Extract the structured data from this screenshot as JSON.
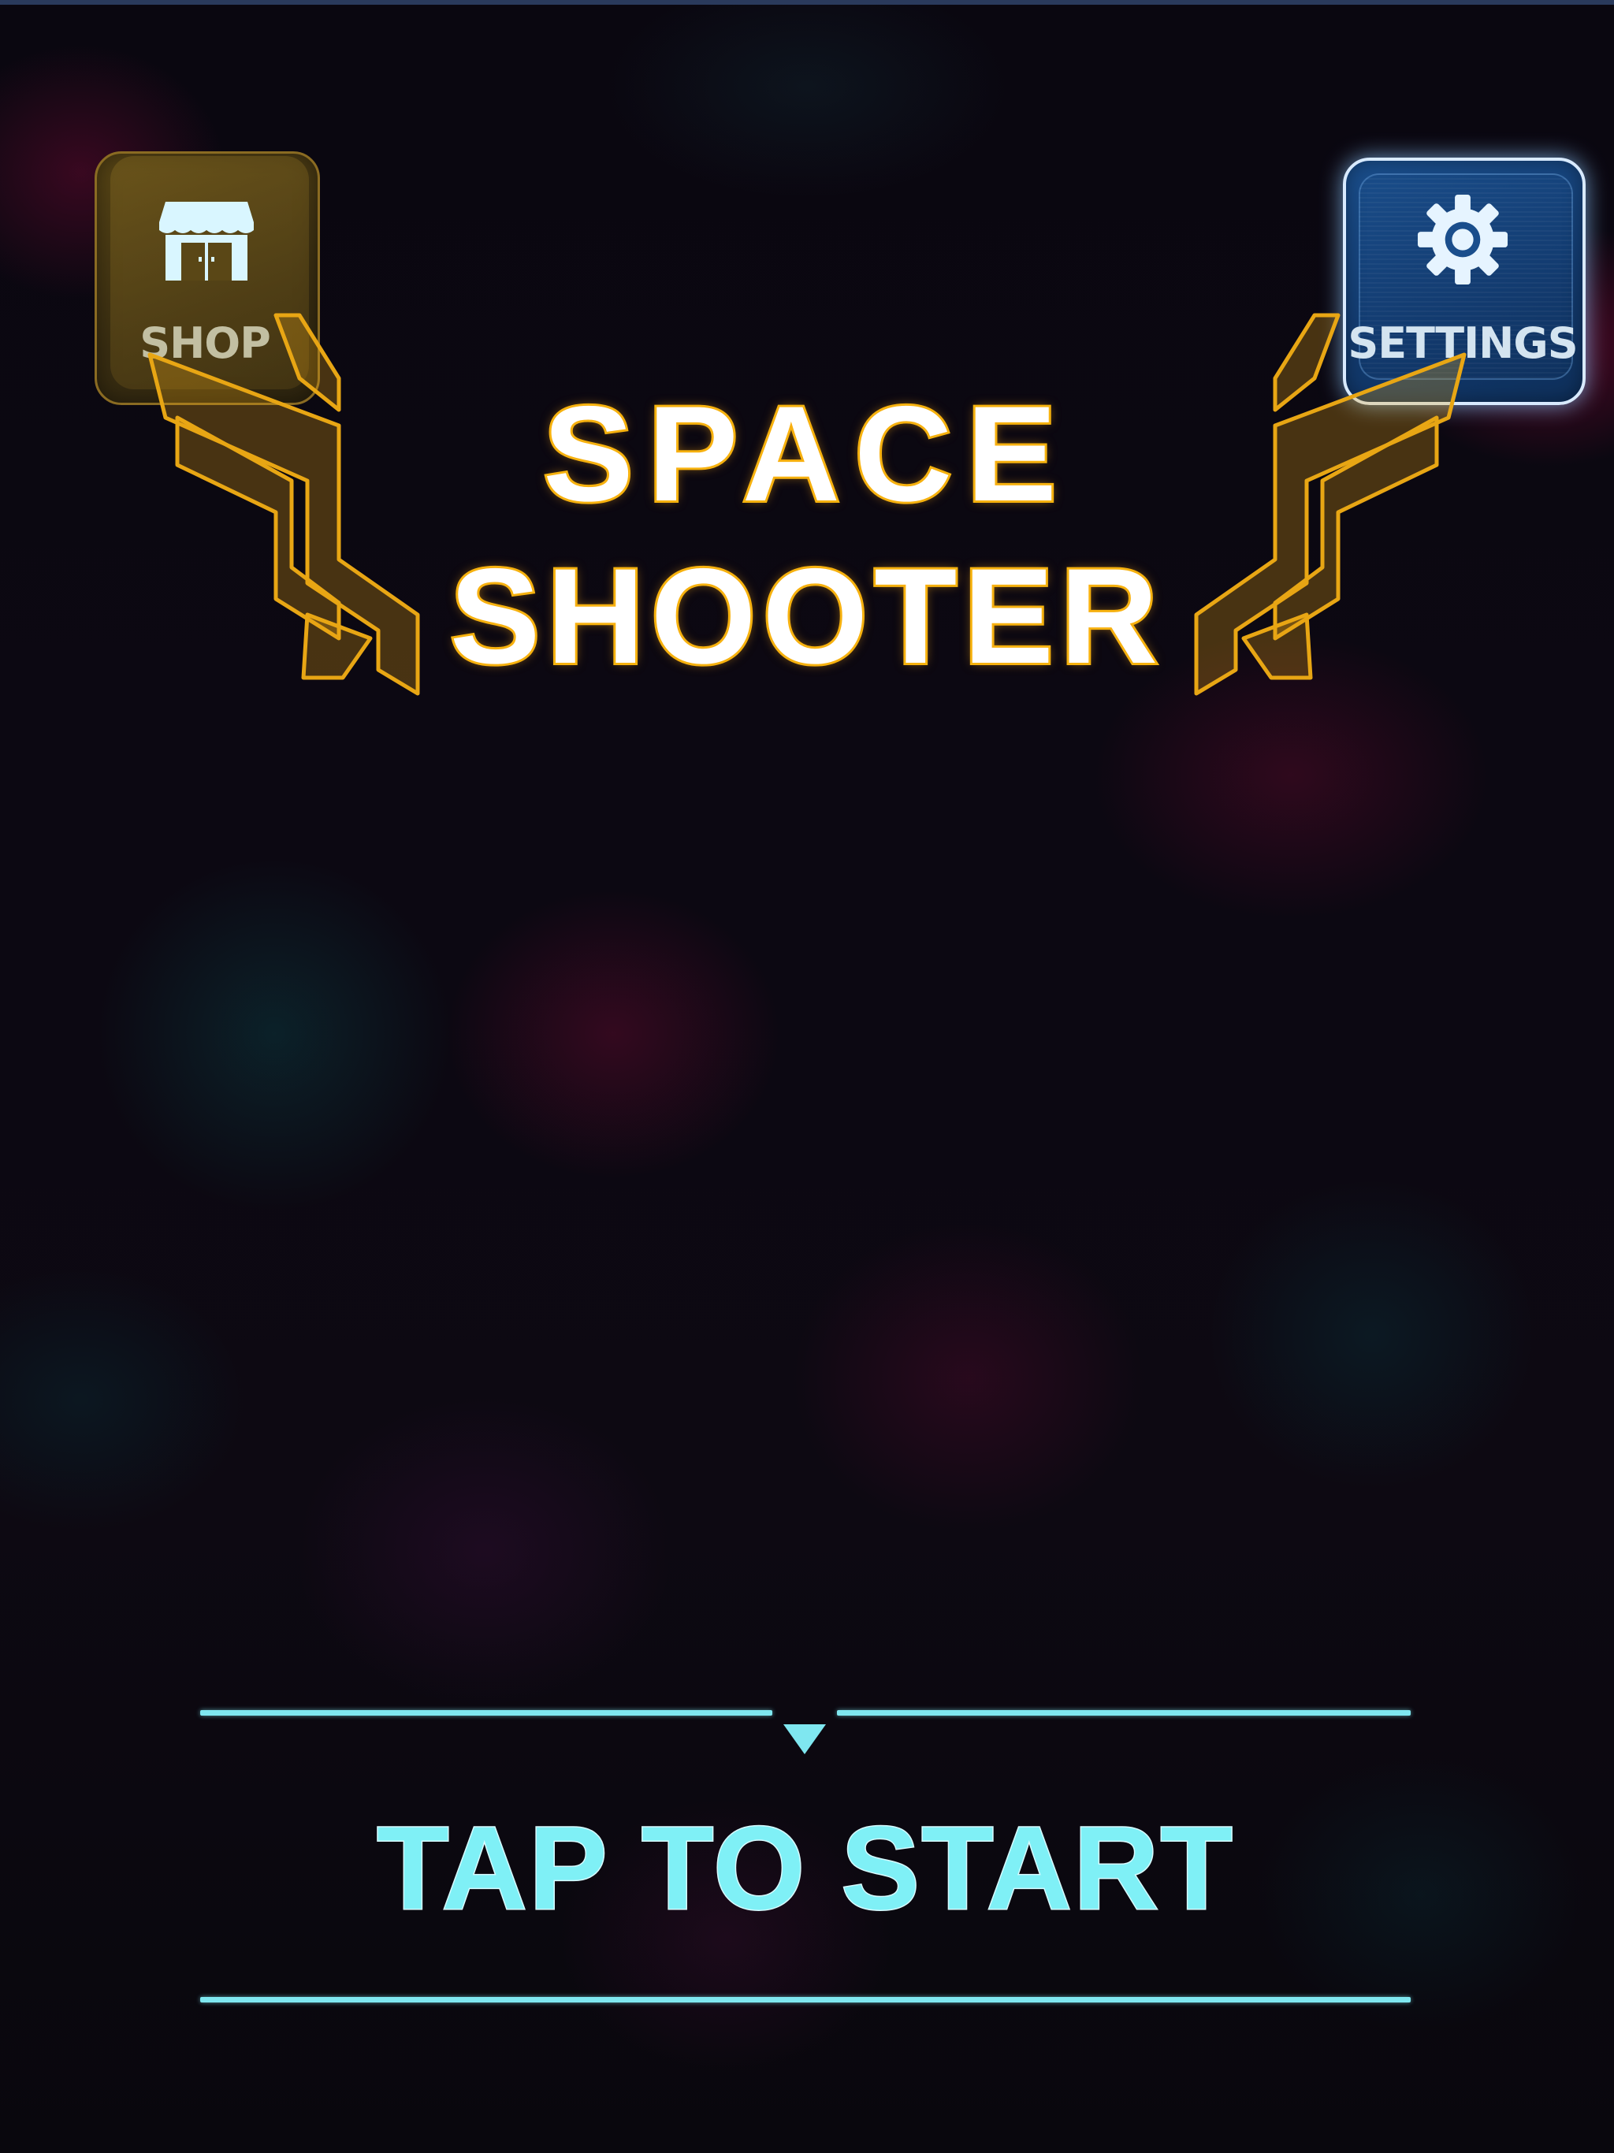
{
  "menu": {
    "shop": {
      "label": "SHOP",
      "icon": "shop-icon"
    },
    "settings": {
      "label": "SETTINGS",
      "icon": "gear-icon"
    }
  },
  "title": {
    "line1": "SPACE",
    "line2": "SHOOTER"
  },
  "start": {
    "label": "TAP TO START",
    "indicator_icon": "down-arrow-icon"
  },
  "colors": {
    "title_fill": "#ffffff",
    "title_outline": "#f4b40e",
    "gold_accent": "#e8a614",
    "cyan_accent": "#7fe7f0",
    "settings_blue": "#1a4e8c",
    "background": "#0a0710"
  }
}
